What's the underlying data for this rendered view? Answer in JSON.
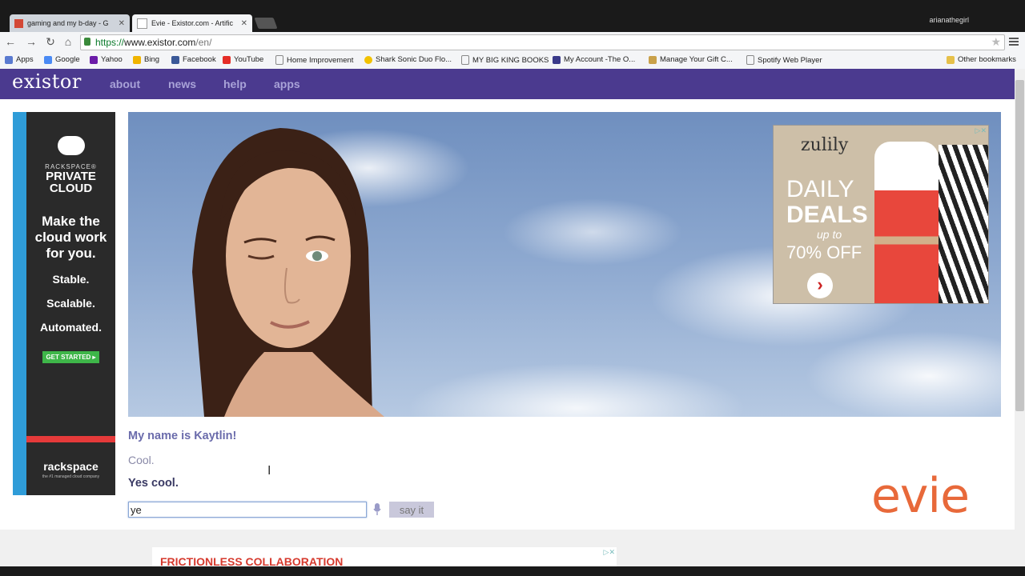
{
  "browser": {
    "tabs": [
      {
        "label": "gaming and my b-day - G"
      },
      {
        "label": "Evie - Existor.com - Artific"
      }
    ],
    "user": "arianathegirl",
    "url": {
      "https": "https://",
      "host": "www.existor.com",
      "path": "/en/"
    },
    "bookmarks": [
      {
        "label": "Apps"
      },
      {
        "label": "Google"
      },
      {
        "label": "Yahoo"
      },
      {
        "label": "Bing"
      },
      {
        "label": "Facebook"
      },
      {
        "label": "YouTube"
      },
      {
        "label": "Home Improvement"
      },
      {
        "label": "Shark Sonic Duo Flo..."
      },
      {
        "label": "MY BIG KING BOOKS"
      },
      {
        "label": "My Account -The O..."
      },
      {
        "label": "Manage Your Gift C..."
      },
      {
        "label": "Spotify Web Player"
      },
      {
        "label": "Other bookmarks"
      }
    ]
  },
  "site": {
    "logo": "existor",
    "nav": [
      {
        "label": "about"
      },
      {
        "label": "news"
      },
      {
        "label": "help"
      },
      {
        "label": "apps"
      }
    ]
  },
  "ads": {
    "left": {
      "brand_line": "RACKSPACE®",
      "product": "PRIVATE CLOUD",
      "headline": "Make the cloud work for you.",
      "points": [
        "Stable.",
        "Scalable.",
        "Automated."
      ],
      "cta": "GET STARTED ▸",
      "logo": "rackspace",
      "tagline": "the #1 managed cloud company"
    },
    "right": {
      "brand": "zulily",
      "line1": "DAILY",
      "line2": "DEALS",
      "upto": "up to",
      "discount": "70% OFF"
    },
    "bottom": {
      "headline": "FRICTIONLESS COLLABORATION"
    }
  },
  "chat": {
    "user_said": "My name is Kaytlin!",
    "bot_reply_1": "Cool.",
    "bot_reply_2": "Yes cool.",
    "input_value": "ye",
    "say_button": "say it"
  },
  "brand_logo": "evie",
  "colors": {
    "header": "#4b3a8f",
    "accent": "#e8693a"
  }
}
